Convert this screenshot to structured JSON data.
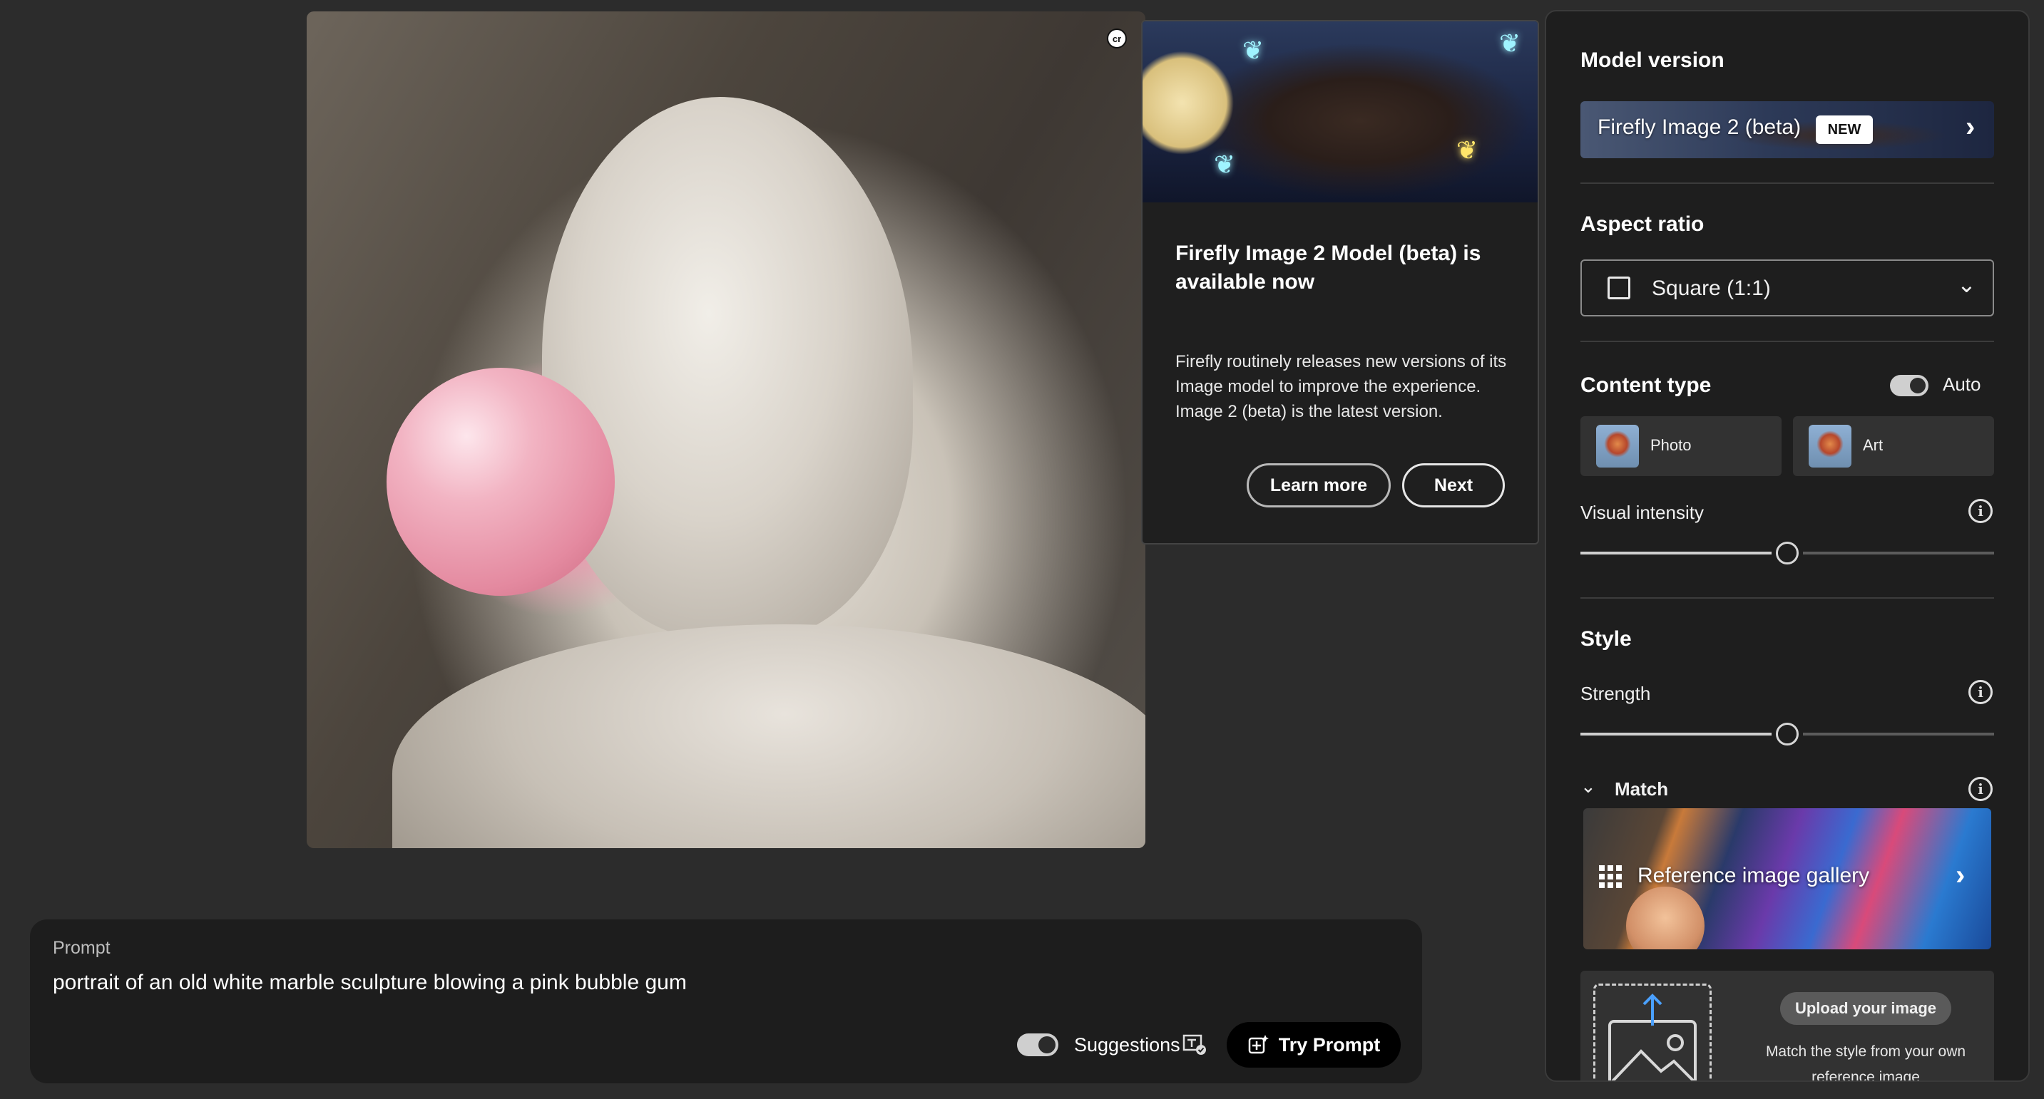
{
  "image": {
    "badge_label": "cr"
  },
  "tooltip": {
    "title": "Firefly Image 2 Model (beta) is available now",
    "body": "Firefly routinely releases new versions of its Image model to improve the experience. Image 2 (beta) is the latest version.",
    "learn_more_label": "Learn more",
    "next_label": "Next"
  },
  "prompt": {
    "label": "Prompt",
    "text": "portrait of an old white marble sculpture blowing a pink bubble gum",
    "suggestions_label": "Suggestions",
    "suggestions_on": true,
    "try_prompt_label": "Try Prompt"
  },
  "settings": {
    "model_version": {
      "title": "Model version",
      "value": "Firefly Image 2 (beta)",
      "badge": "NEW"
    },
    "aspect_ratio": {
      "title": "Aspect ratio",
      "value": "Square (1:1)"
    },
    "content_type": {
      "title": "Content type",
      "auto_label": "Auto",
      "auto_on": true,
      "options": [
        "Photo",
        "Art"
      ],
      "visual_intensity_label": "Visual intensity",
      "visual_intensity_level": 0.5
    },
    "style": {
      "title": "Style",
      "strength_label": "Strength",
      "strength_level": 0.5,
      "match_label": "Match",
      "gallery_label": "Reference image gallery",
      "upload_button_label": "Upload your image",
      "upload_desc": "Match the style from your own reference image"
    }
  },
  "colors": {
    "background": "#2c2c2c",
    "panel": "#1e1e1e",
    "accent": "#ffffff"
  }
}
